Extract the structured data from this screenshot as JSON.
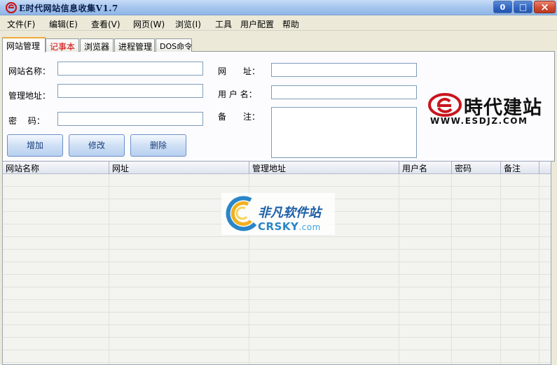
{
  "window": {
    "title": "E时代网站信息收集V1.7",
    "minimize": "0",
    "maximize": "□",
    "close": "×"
  },
  "menu": [
    "文件(F)",
    "编辑(E)",
    "查看(V)",
    "网页(W)",
    "浏览(I)",
    "工具",
    "用户配置",
    "帮助"
  ],
  "tabs": [
    {
      "label": "网站管理",
      "active": true
    },
    {
      "label": "记事本",
      "active": false
    },
    {
      "label": "浏览器",
      "active": false
    },
    {
      "label": "进程管理",
      "active": false
    },
    {
      "label": "DOS命令",
      "active": false
    }
  ],
  "form": {
    "site_name_label": "网站名称：",
    "admin_url_label": "管理地址：",
    "password_label": "密　 码：",
    "url_label": "网　　址：",
    "username_label": "用 户 名：",
    "notes_label": "备　　注：",
    "site_name_value": "",
    "admin_url_value": "",
    "password_value": "",
    "url_value": "",
    "username_value": "",
    "notes_value": ""
  },
  "buttons": {
    "add": "增加",
    "edit": "修改",
    "delete": "删除"
  },
  "brand": {
    "name": "時代建站",
    "url": "WWW.ESDJZ.COM",
    "color": "#c8161d"
  },
  "grid": {
    "columns": [
      "网站名称",
      "网址",
      "管理地址",
      "用户名",
      "密码",
      "备注"
    ]
  },
  "watermark": {
    "cn": "非凡软件站",
    "en": "CRSKY",
    "suffix": ".com"
  }
}
